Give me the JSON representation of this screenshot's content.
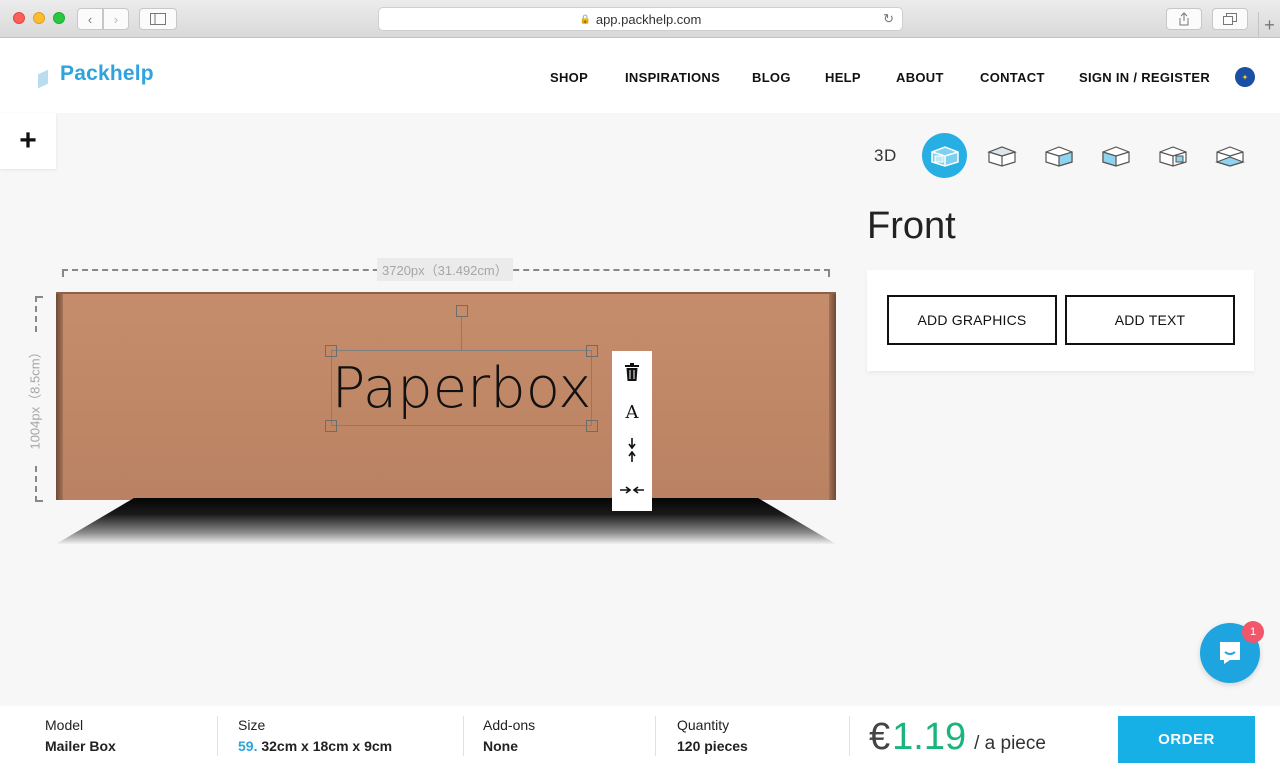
{
  "browser": {
    "url": "app.packhelp.com"
  },
  "header": {
    "logo": "Packhelp",
    "nav": [
      {
        "label": "SHOP"
      },
      {
        "label": "INSPIRATIONS"
      },
      {
        "label": "BLOG"
      },
      {
        "label": "HELP"
      },
      {
        "label": "ABOUT"
      },
      {
        "label": "CONTACT"
      },
      {
        "label": "SIGN IN / REGISTER"
      }
    ]
  },
  "editor": {
    "plus_label": "+",
    "view_3d_label": "3D",
    "views": [
      "front-view-icon",
      "top-view-icon",
      "right-view-icon",
      "left-view-icon",
      "back-view-icon",
      "bottom-view-icon"
    ],
    "side_title": "Front",
    "add_graphics_label": "ADD GRAPHICS",
    "add_text_label": "ADD TEXT",
    "width_label": "3720px（31.492cm）",
    "height_label": "1004px（8.5cm）",
    "box_text": "Paperbox",
    "toolbar": {
      "font_label": "A"
    }
  },
  "chat": {
    "badge_count": "1"
  },
  "summary": {
    "model_label": "Model",
    "model_value": "Mailer Box",
    "size_label": "Size",
    "size_number": "59.",
    "size_value": "32cm x 18cm x 9cm",
    "addons_label": "Add-ons",
    "addons_value": "None",
    "quantity_label": "Quantity",
    "quantity_value": "120 pieces",
    "price_currency": "€",
    "price_value": "1.19",
    "price_unit": "/ a piece",
    "order_label": "ORDER"
  },
  "colors": {
    "brand": "#2ea3dd",
    "order_button": "#16b0e6",
    "price": "#19b57c",
    "box_kraft": "#c08866"
  }
}
